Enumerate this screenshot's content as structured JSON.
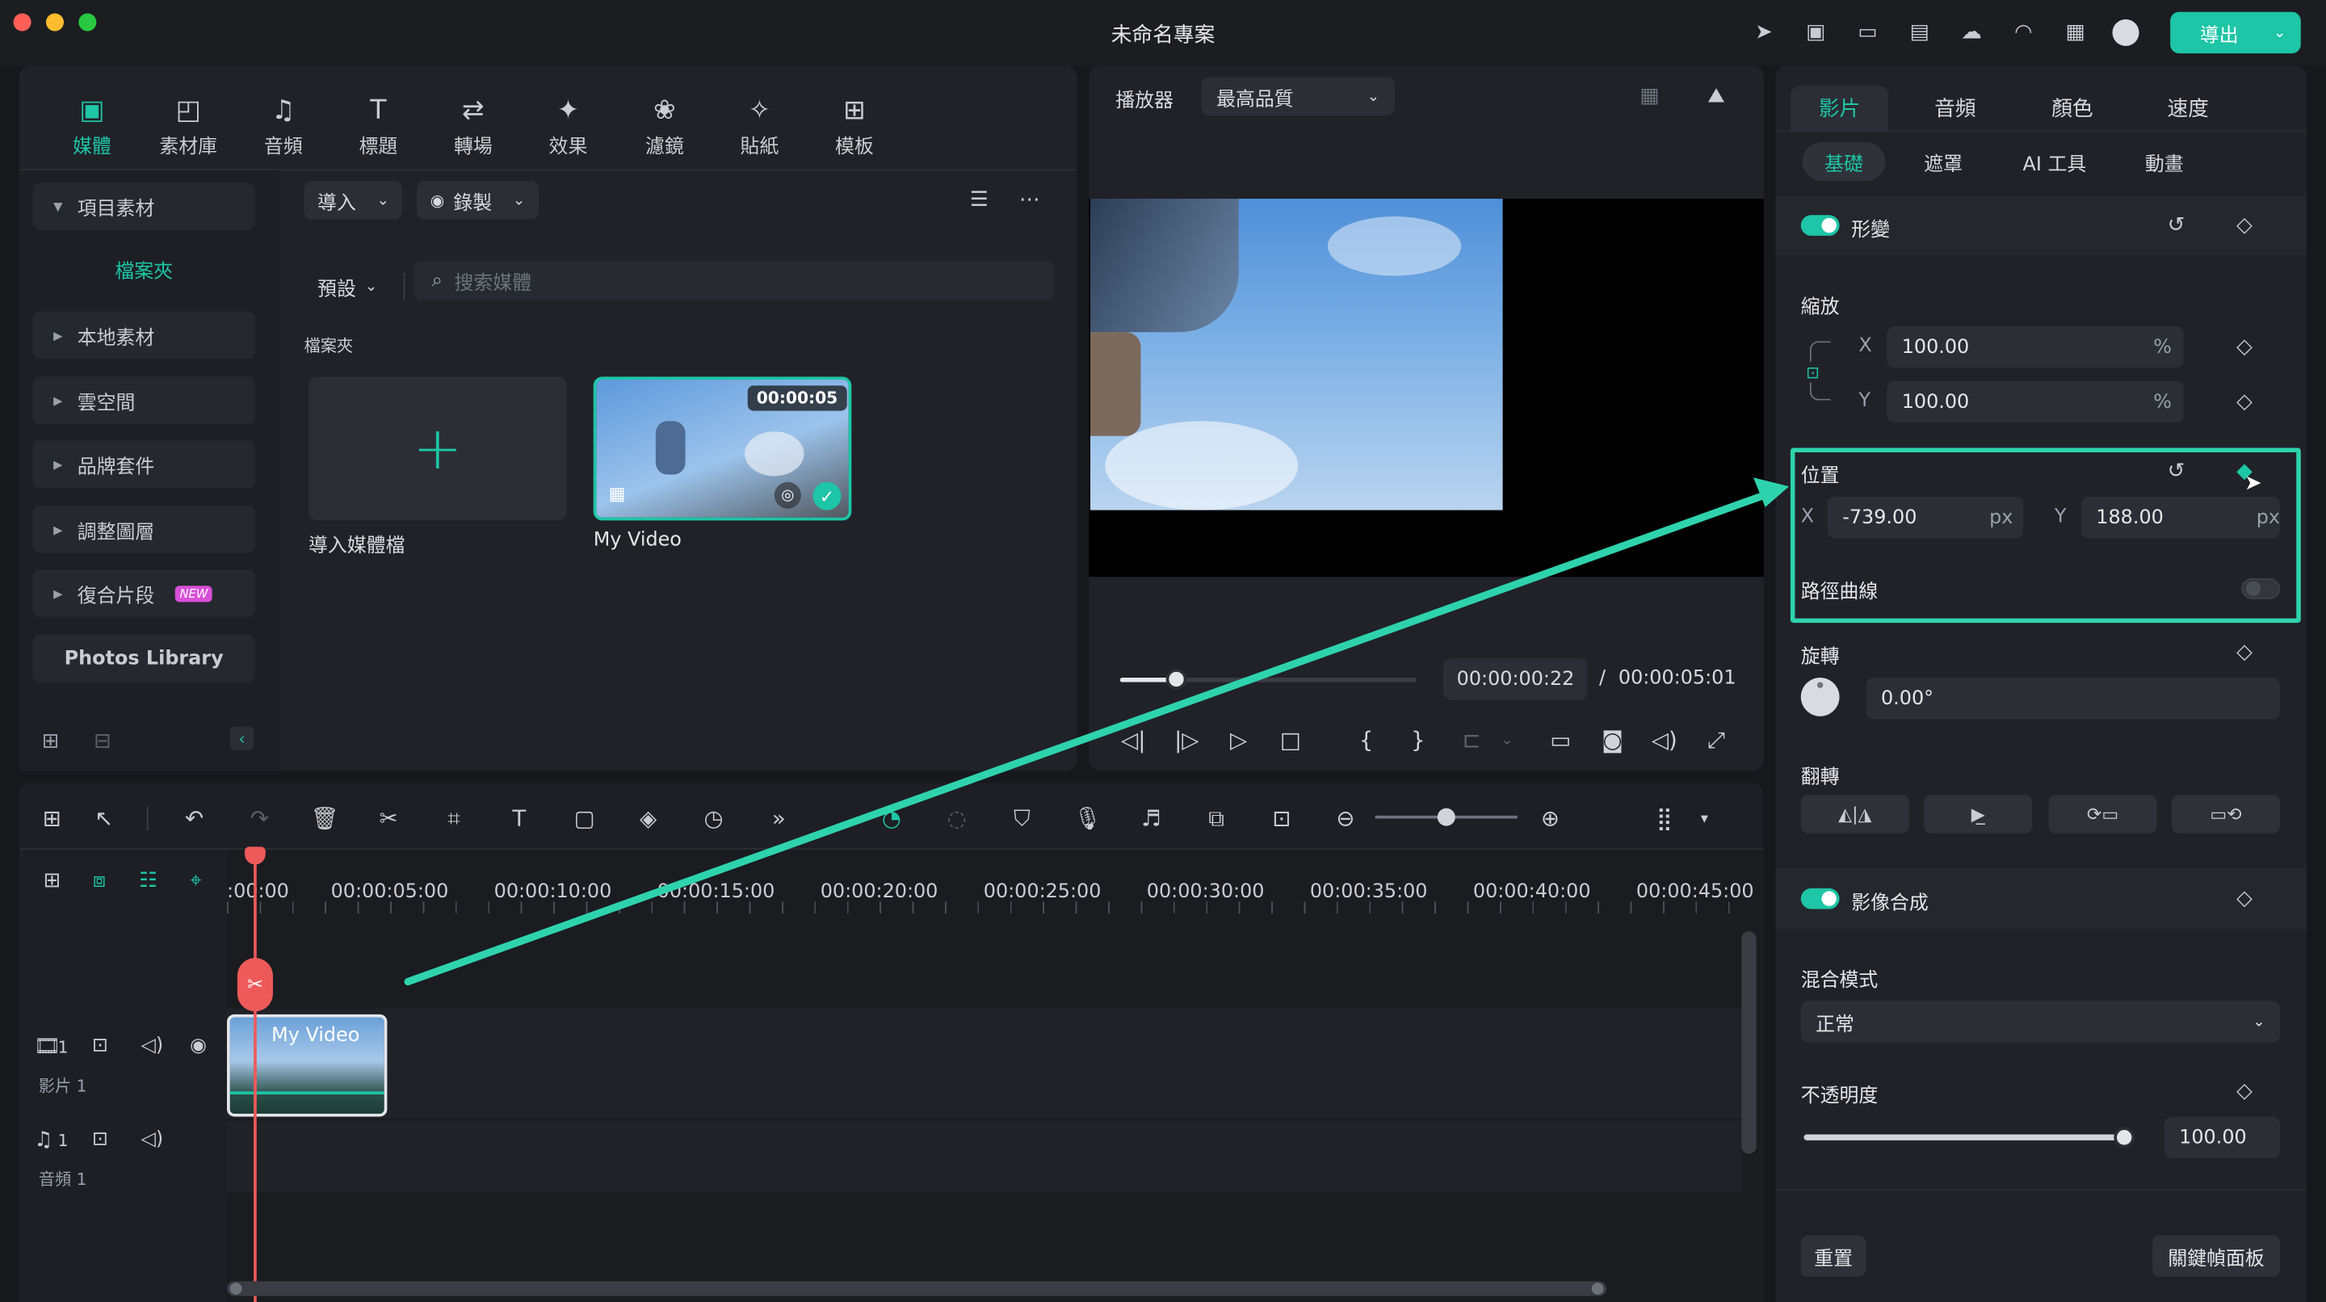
{
  "window": {
    "title": "未命名專案",
    "export_label": "導出"
  },
  "colors": {
    "accent": "#1ec5a6",
    "playhead": "#ee5a5a",
    "new_badge": "#d94fd8"
  },
  "left_panel": {
    "tabs": [
      {
        "label": "媒體",
        "icon": "media-icon"
      },
      {
        "label": "素材庫",
        "icon": "stock-library-icon"
      },
      {
        "label": "音頻",
        "icon": "music-note-icon"
      },
      {
        "label": "標題",
        "icon": "title-t-icon"
      },
      {
        "label": "轉場",
        "icon": "transition-icon"
      },
      {
        "label": "效果",
        "icon": "effects-star-icon"
      },
      {
        "label": "濾鏡",
        "icon": "filter-icon"
      },
      {
        "label": "貼紙",
        "icon": "sticker-icon"
      },
      {
        "label": "模板",
        "icon": "template-icon"
      }
    ],
    "sidebar": {
      "project_media": "項目素材",
      "folder": "檔案夾",
      "items": [
        "本地素材",
        "雲空間",
        "品牌套件",
        "調整圖層",
        "復合片段"
      ],
      "new_badge": "NEW",
      "photos_library": "Photos Library"
    },
    "toolbar": {
      "import": "導入",
      "record": "錄製"
    },
    "filter": {
      "preset": "預設",
      "search_placeholder": "搜索媒體"
    },
    "folder_label": "檔案夾",
    "cards": {
      "import_label": "導入媒體檔",
      "video_label": "My Video",
      "video_duration": "00:00:05"
    }
  },
  "player": {
    "label": "播放器",
    "quality": "最高品質",
    "current_time": "00:00:00:22",
    "separator": "/",
    "total_time": "00:00:05:01",
    "progress": 0.19
  },
  "right_panel": {
    "tabs": [
      "影片",
      "音頻",
      "顏色",
      "速度"
    ],
    "subtabs": [
      "基礎",
      "遮罩",
      "AI 工具",
      "動畫"
    ],
    "transform": {
      "label": "形變"
    },
    "scale": {
      "label": "縮放",
      "x_label": "X",
      "x": "100.00",
      "y_label": "Y",
      "y": "100.00",
      "unit": "%"
    },
    "position": {
      "label": "位置",
      "x_label": "X",
      "x": "-739.00",
      "y_label": "Y",
      "y": "188.00",
      "unit": "px",
      "path_curve": "路徑曲線"
    },
    "rotation": {
      "label": "旋轉",
      "value": "0.00°"
    },
    "flip": {
      "label": "翻轉"
    },
    "compositing": {
      "label": "影像合成",
      "blend_label": "混合模式",
      "blend_value": "正常",
      "opacity_label": "不透明度",
      "opacity": "100.00",
      "opacity_level": 1.0
    },
    "reset": "重置",
    "keyframe_panel": "關鍵幀面板"
  },
  "timeline": {
    "ticks": [
      ":00:00",
      "00:00:05:00",
      "00:00:10:00",
      "00:00:15:00",
      "00:00:20:00",
      "00:00:25:00",
      "00:00:30:00",
      "00:00:35:00",
      "00:00:40:00",
      "00:00:45:00"
    ],
    "clip_label": "My Video",
    "video_track": {
      "number": "1",
      "label": "影片 1"
    },
    "audio_track": {
      "number": "1",
      "label": "音頻 1"
    }
  }
}
